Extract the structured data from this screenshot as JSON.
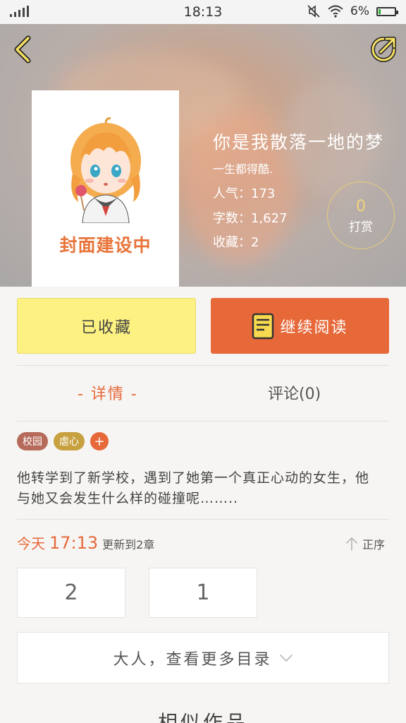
{
  "status_bar": {
    "time": "18:13",
    "battery": "6%",
    "icons": [
      "signal-icon",
      "mute-icon",
      "wifi-icon",
      "battery-icon"
    ]
  },
  "header": {
    "back_icon": "chevron-left-icon",
    "share_icon": "share-icon",
    "cover_text": "封面建设中",
    "title": "你是我散落一地的梦",
    "author": "一生都得酷.",
    "popularity": "人气：173",
    "word_count": "字数：1,627",
    "favorites": "收藏：2",
    "tip_count": "0",
    "tip_label": "打赏"
  },
  "actions": {
    "favorite_label": "已收藏",
    "read_label": "继续阅读",
    "read_icon": "book-icon"
  },
  "tabs": {
    "detail": "- 详情 -",
    "comment": "评论(0)"
  },
  "tags": [
    {
      "label": "校园",
      "color": "#b66a5a"
    },
    {
      "label": "虐心",
      "color": "#c7a03f"
    }
  ],
  "tag_add": "+",
  "description": "他转学到了新学校，遇到了她第一个真正心动的女生，他与她又会发生什么样的碰撞呢……..",
  "update": {
    "day": "今天",
    "time": "17:13",
    "text": "更新到2章"
  },
  "order_label": "正序",
  "chapters": [
    "2",
    "1"
  ],
  "more_label": "大人，查看更多目录",
  "similar_label": "相似作品",
  "colors": {
    "accent": "#e7693a",
    "favorite_bg": "#fcf181",
    "gold": "#f0d37a"
  }
}
